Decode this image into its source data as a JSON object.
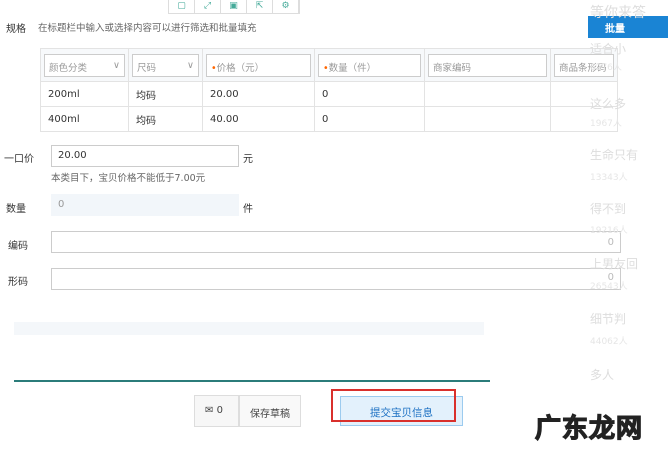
{
  "toolbar": {
    "icons": [
      "doc-icon",
      "expand-icon",
      "save-icon",
      "export-icon",
      "settings-icon"
    ]
  },
  "spec": {
    "label": "规格",
    "hint": "在标题栏中输入或选择内容可以进行筛选和批量填充",
    "batch_button": "批量"
  },
  "table": {
    "headers": [
      "颜色分类",
      "尺码",
      "价格（元）",
      "数量（件）",
      "商家编码",
      "商品条形码"
    ],
    "rows": [
      [
        "200ml",
        "均码",
        "20.00",
        "0",
        "",
        ""
      ],
      [
        "400ml",
        "均码",
        "40.00",
        "0",
        "",
        ""
      ]
    ]
  },
  "price": {
    "label": "一口价",
    "value": "20.00",
    "unit": "元",
    "hint": "本类目下，宝贝价格不能低于7.00元"
  },
  "quantity": {
    "label": "数量",
    "value": "0",
    "unit": "件"
  },
  "merchant_code": {
    "label": "编码",
    "counter": "0"
  },
  "barcode": {
    "label": "形码",
    "counter": "0"
  },
  "sidebar": {
    "title": "等你来答",
    "items": [
      {
        "q": "适合小",
        "s": "6276人"
      },
      {
        "q": "这么多",
        "s": "1967人"
      },
      {
        "q": "生命只有",
        "s": "13343人"
      },
      {
        "q": "得不到",
        "s": "19216人"
      },
      {
        "q": "上男友回",
        "s": "26543人"
      },
      {
        "q": "细节判",
        "s": "44062人"
      },
      {
        "q": "多人"
      }
    ]
  },
  "footer": {
    "message_count": "0",
    "save_draft": "保存草稿",
    "submit": "提交宝贝信息"
  },
  "watermark": "广东龙网"
}
